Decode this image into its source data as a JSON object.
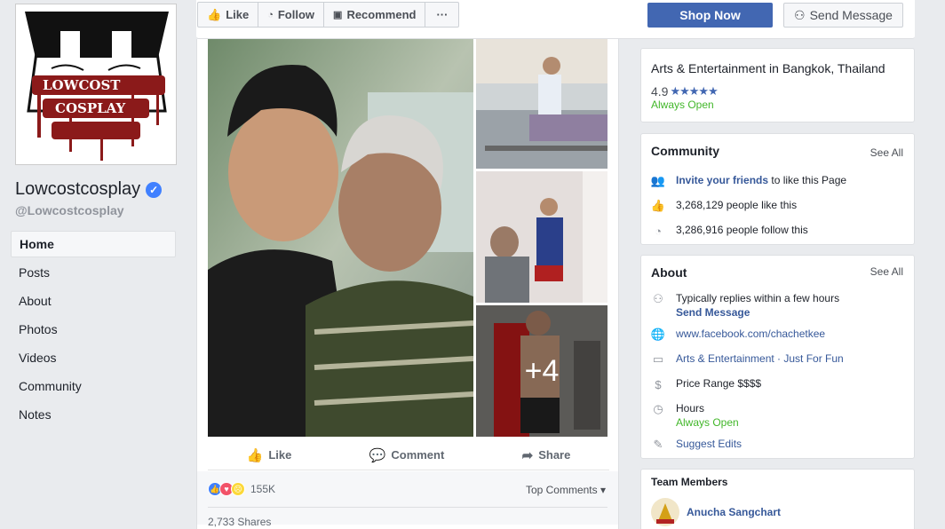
{
  "page": {
    "name": "Lowcostcosplay",
    "handle": "@Lowcostcosplay",
    "logo_text": "LOWCOST COSPLAY"
  },
  "nav": [
    {
      "label": "Home",
      "active": true
    },
    {
      "label": "Posts"
    },
    {
      "label": "About"
    },
    {
      "label": "Photos"
    },
    {
      "label": "Videos"
    },
    {
      "label": "Community"
    },
    {
      "label": "Notes"
    }
  ],
  "actionbar": {
    "like": "Like",
    "follow": "Follow",
    "recommend": "Recommend",
    "more": "···",
    "shop_now": "Shop Now",
    "send_message": "Send Message"
  },
  "post": {
    "more_photos": "+4",
    "actions": {
      "like": "Like",
      "comment": "Comment",
      "share": "Share"
    },
    "reaction_count": "155K",
    "top_comments": "Top Comments ▾",
    "shares": "2,733 Shares"
  },
  "info": {
    "category": "Arts & Entertainment in Bangkok, Thailand",
    "rating": "4.9",
    "stars": "★★★★★",
    "open": "Always Open"
  },
  "community": {
    "title": "Community",
    "see_all": "See All",
    "invite_link": "Invite your friends",
    "invite_rest": " to like this Page",
    "likes": "3,268,129 people like this",
    "follows": "3,286,916 people follow this"
  },
  "about": {
    "title": "About",
    "see_all": "See All",
    "replies": "Typically replies within a few hours",
    "send_message": "Send Message",
    "website": "www.facebook.com/chachetkee",
    "category": "Arts & Entertainment · Just For Fun",
    "price": "Price Range $$$$",
    "hours_label": "Hours",
    "hours_value": "Always Open",
    "suggest": "Suggest Edits"
  },
  "team": {
    "title": "Team Members",
    "member": "Anucha Sangchart"
  },
  "colors": {
    "fb_blue": "#4267b2",
    "link": "#365899",
    "green": "#42b72a"
  }
}
